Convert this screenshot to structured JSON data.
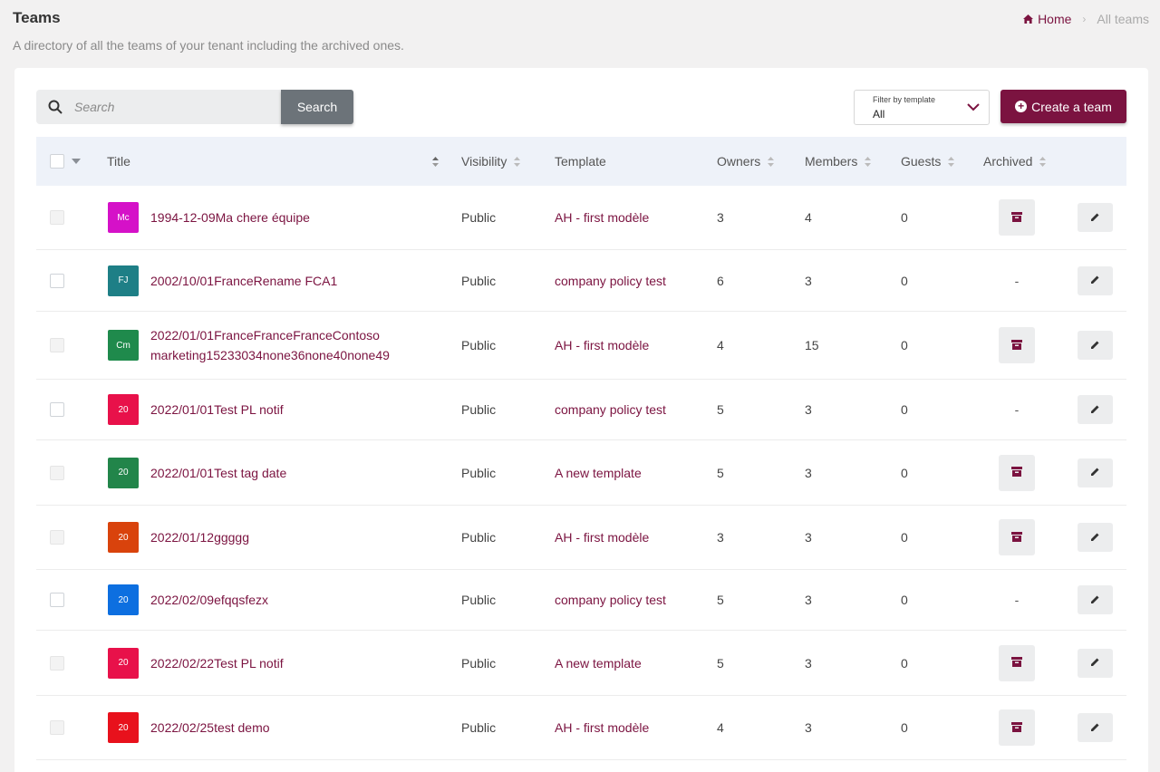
{
  "page": {
    "title": "Teams",
    "subtitle": "A directory of all the teams of your tenant including the archived ones."
  },
  "breadcrumb": {
    "home": "Home",
    "separator": "›",
    "current": "All teams"
  },
  "toolbar": {
    "search_placeholder": "Search",
    "search_button": "Search",
    "filter_label": "Filter by template",
    "filter_value": "All",
    "create_button": "Create a team"
  },
  "table": {
    "headers": {
      "title": "Title",
      "visibility": "Visibility",
      "template": "Template",
      "owners": "Owners",
      "members": "Members",
      "guests": "Guests",
      "archived": "Archived"
    },
    "rows": [
      {
        "initials": "Mc",
        "color": "#d511c8",
        "title1": "1994-12-09Ma chere équipe",
        "title2": "",
        "visibility": "Public",
        "template": "AH - first modèle",
        "owners": "3",
        "members": "4",
        "guests": "0",
        "archived": "",
        "has_archive": true
      },
      {
        "initials": "FJ",
        "color": "#1e7f86",
        "title1": "2002/10/01FranceRename FCA1",
        "title2": "",
        "visibility": "Public",
        "template": "company policy test",
        "owners": "6",
        "members": "3",
        "guests": "0",
        "archived": "-",
        "has_archive": false
      },
      {
        "initials": "Cm",
        "color": "#1f8a4c",
        "title1": "2022/01/01FranceFranceFranceContoso",
        "title2": "marketing15233034none36none40none49",
        "visibility": "Public",
        "template": "AH - first modèle",
        "owners": "4",
        "members": "15",
        "guests": "0",
        "archived": "",
        "has_archive": true
      },
      {
        "initials": "20",
        "color": "#e8114a",
        "title1": "2022/01/01Test PL notif",
        "title2": "",
        "visibility": "Public",
        "template": "company policy test",
        "owners": "5",
        "members": "3",
        "guests": "0",
        "archived": "-",
        "has_archive": false
      },
      {
        "initials": "20",
        "color": "#22854a",
        "title1": "2022/01/01Test tag date",
        "title2": "",
        "visibility": "Public",
        "template": "A new template",
        "owners": "5",
        "members": "3",
        "guests": "0",
        "archived": "",
        "has_archive": true
      },
      {
        "initials": "20",
        "color": "#d9430c",
        "title1": "2022/01/12ggggg",
        "title2": "",
        "visibility": "Public",
        "template": "AH - first modèle",
        "owners": "3",
        "members": "3",
        "guests": "0",
        "archived": "",
        "has_archive": true
      },
      {
        "initials": "20",
        "color": "#0d6fe0",
        "title1": "2022/02/09efqqsfezx",
        "title2": "",
        "visibility": "Public",
        "template": "company policy test",
        "owners": "5",
        "members": "3",
        "guests": "0",
        "archived": "-",
        "has_archive": false
      },
      {
        "initials": "20",
        "color": "#e8114a",
        "title1": "2022/02/22Test PL notif",
        "title2": "",
        "visibility": "Public",
        "template": "A new template",
        "owners": "5",
        "members": "3",
        "guests": "0",
        "archived": "",
        "has_archive": true
      },
      {
        "initials": "20",
        "color": "#e8111c",
        "title1": "2022/02/25test demo",
        "title2": "",
        "visibility": "Public",
        "template": "AH - first modèle",
        "owners": "4",
        "members": "3",
        "guests": "0",
        "archived": "",
        "has_archive": true
      }
    ]
  },
  "colors": {
    "accent": "#7b1340",
    "header_bg": "#eef2f9",
    "search_button": "#6c7379"
  }
}
